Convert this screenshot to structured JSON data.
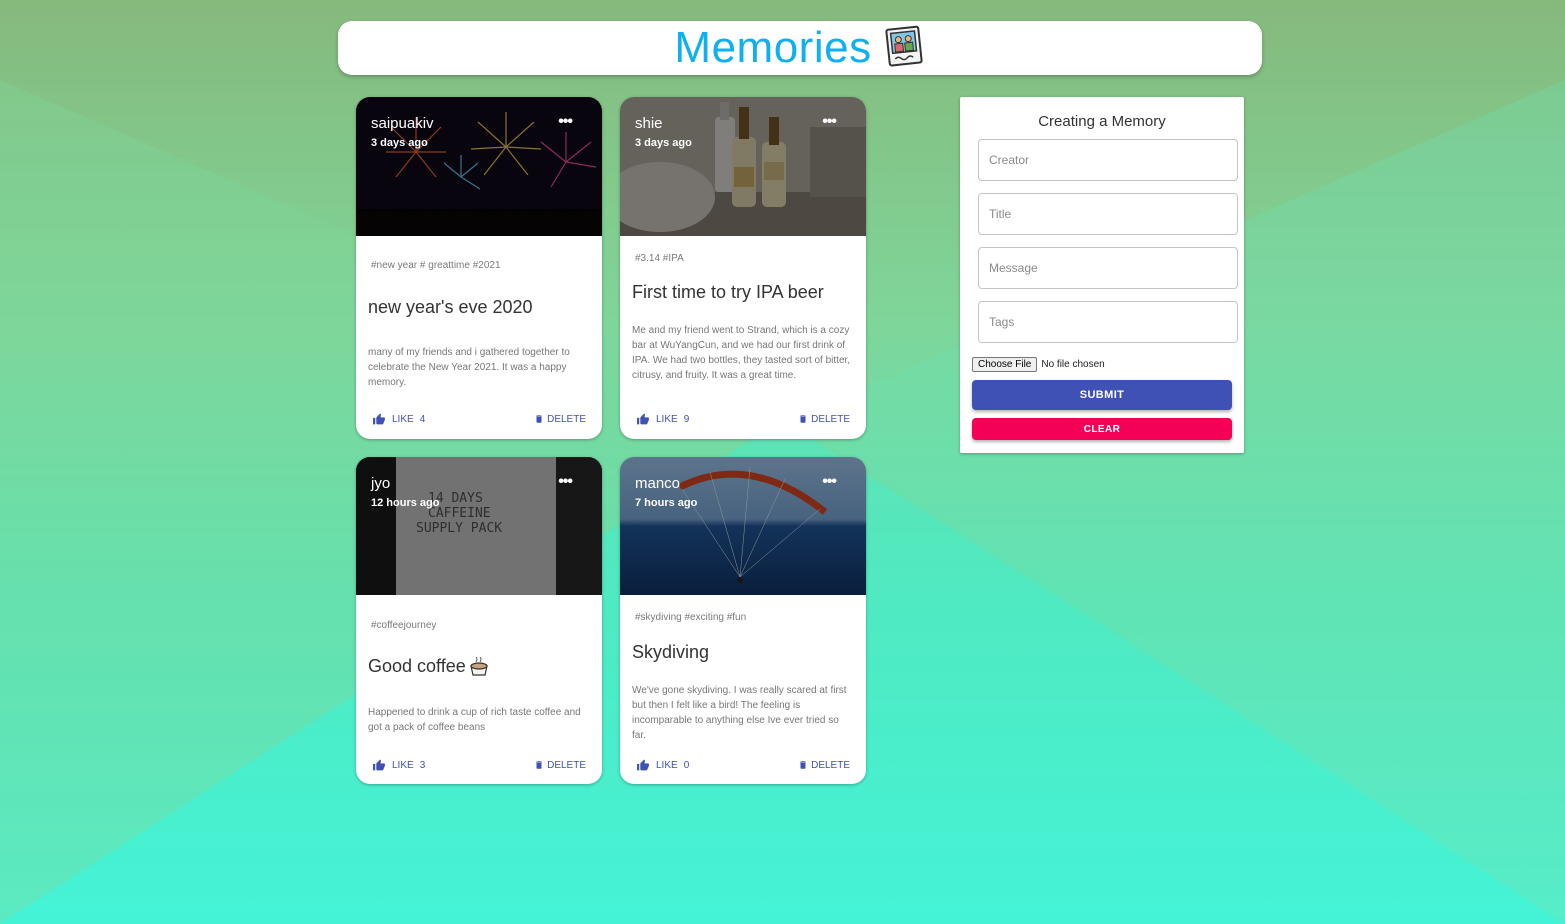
{
  "app": {
    "title": "Memories",
    "logo_icon": "photo-frame-icon"
  },
  "posts": [
    {
      "creator": "saipuakiv",
      "time": "3 days ago",
      "tags": "#new year # greattime #2021",
      "title": "new year's eve 2020",
      "message": "many of my friends and i gathered together to celebrate the New Year 2021. It was a happy memory.",
      "like_label": "LIKE",
      "like_count": "4",
      "delete_label": "DELETE",
      "image": "fireworks"
    },
    {
      "creator": "shie",
      "time": "3 days ago",
      "tags": "#3.14 #IPA",
      "title": "First time to try IPA beer",
      "message": "Me and my friend went to Strand, which is a cozy bar at WuYangCun, and we had our first drink of IPA. We had two bottles, they tasted sort of bitter, citrusy, and fruity. It was a great time.",
      "like_label": "LIKE",
      "like_count": "9",
      "delete_label": "DELETE",
      "image": "bottles"
    },
    {
      "creator": "jyo",
      "time": "12 hours ago",
      "tags": "#coffeejourney",
      "title": "Good coffee",
      "message": "Happened to drink a cup of rich taste coffee and got a pack of coffee beans",
      "like_label": "LIKE",
      "like_count": "3",
      "delete_label": "DELETE",
      "image": "coffee-pack",
      "image_text": [
        "14 DAYS",
        "CAFFEINE",
        "SUPPLY PACK"
      ]
    },
    {
      "creator": "manco",
      "time": "7 hours ago",
      "tags": "#skydiving #exciting #fun",
      "title": "Skydiving",
      "message": "We've gone skydiving. I was really scared at first but then I felt like a bird! The feeling is incomparable to anything else Ive ever tried so far.",
      "like_label": "LIKE",
      "like_count": "0",
      "delete_label": "DELETE",
      "image": "paraglider"
    }
  ],
  "form": {
    "title": "Creating a Memory",
    "creator_placeholder": "Creator",
    "title_placeholder": "Title",
    "message_placeholder": "Message",
    "tags_placeholder": "Tags",
    "choose_file_label": "Choose File",
    "no_file_text": "No file chosen",
    "submit_label": "SUBMIT",
    "clear_label": "CLEAR"
  },
  "colors": {
    "brand": "#0fb0ef",
    "primary": "#3f51b5",
    "secondary": "#f50057"
  }
}
